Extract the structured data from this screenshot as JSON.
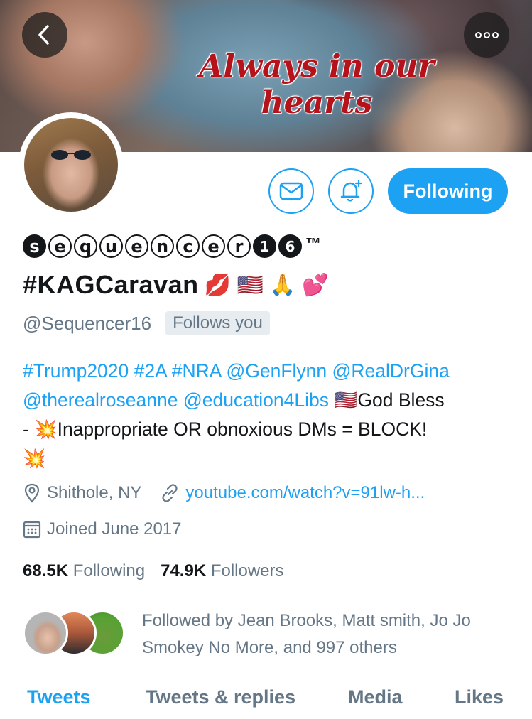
{
  "banner": {
    "caption": "Always in our hearts"
  },
  "profile": {
    "name_letters": [
      "s",
      "e",
      "q",
      "u",
      "e",
      "n",
      "c",
      "e",
      "r"
    ],
    "name_digits": [
      "1",
      "6"
    ],
    "name_tm": "™",
    "name_hashtag": "#KAGCaravan",
    "name_emojis": [
      "💋",
      "🇺🇸",
      "🙏",
      "💕"
    ],
    "handle": "@Sequencer16",
    "follows_you": "Follows you",
    "follow_button": "Following"
  },
  "bio": {
    "links_line1": [
      "#Trump2020",
      "#2A",
      "#NRA",
      "@GenFlynn",
      "@RealDrGina"
    ],
    "links_line2": [
      "@therealroseanne",
      "@education4Libs"
    ],
    "flag_emoji": "🇺🇸",
    "text_god_bless": "God Bless",
    "text_dash": "-",
    "boom_emoji": "💥",
    "text_rule": "Inappropriate OR obnoxious DMs = BLOCK!"
  },
  "meta": {
    "location": "Shithole, NY",
    "website": "youtube.com/watch?v=91lw-h...",
    "joined": "Joined June 2017"
  },
  "counts": {
    "following_value": "68.5K",
    "following_label": "Following",
    "followers_value": "74.9K",
    "followers_label": "Followers"
  },
  "followed_by": "Followed by Jean Brooks, Matt smith, Jo Jo Smokey No More, and 997 others",
  "tabs": [
    "Tweets",
    "Tweets & replies",
    "Media",
    "Likes"
  ],
  "colors": {
    "accent": "#1da1f2",
    "muted": "#657786",
    "caption_red": "#b5121b"
  }
}
